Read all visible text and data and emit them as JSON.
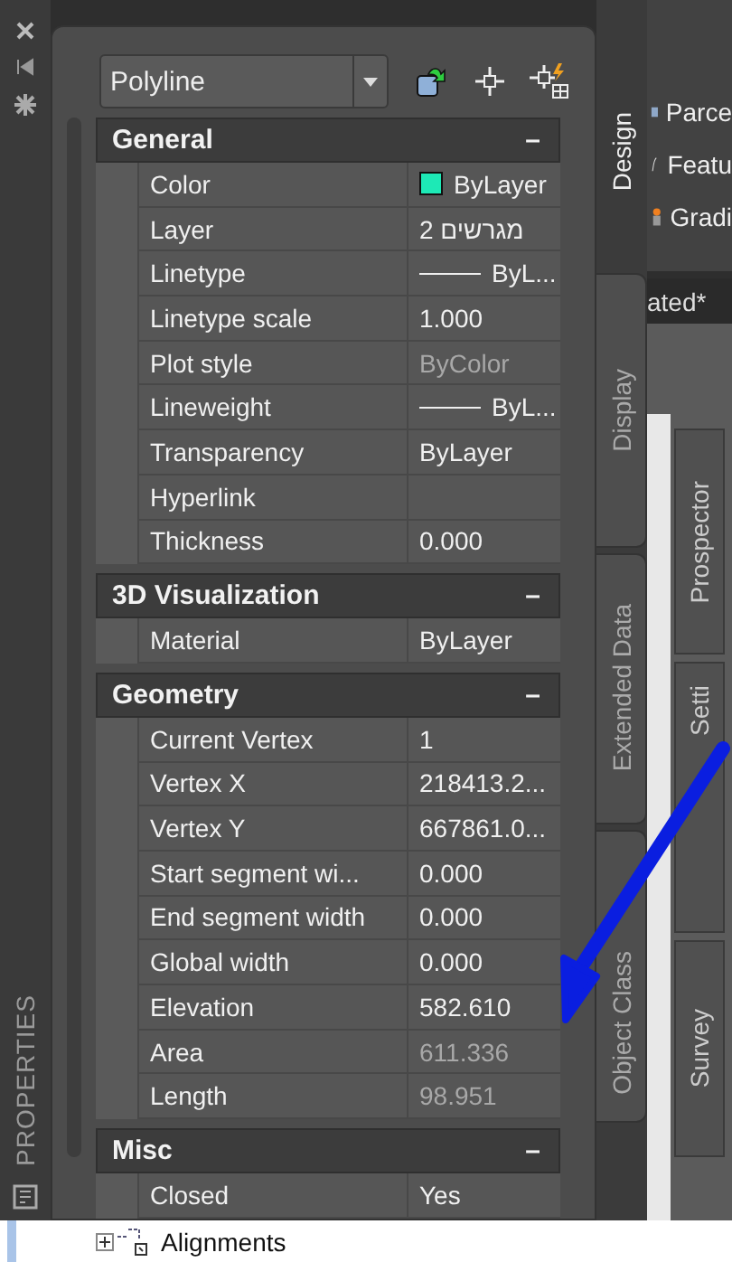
{
  "palette": {
    "title": "PROPERTIES",
    "object_type": "Polyline",
    "groups": [
      {
        "title": "General",
        "toggle": "–",
        "expanded": true,
        "rows": [
          {
            "label": "Color",
            "value": "ByLayer",
            "kind": "color",
            "color": "#1de9b6",
            "disabled": false
          },
          {
            "label": "Layer",
            "value": "מגרשים 2",
            "kind": "text",
            "disabled": false
          },
          {
            "label": "Linetype",
            "value": "ByL...",
            "kind": "line",
            "disabled": false
          },
          {
            "label": "Linetype scale",
            "value": "1.000",
            "kind": "text",
            "disabled": false
          },
          {
            "label": "Plot style",
            "value": "ByColor",
            "kind": "text",
            "disabled": true
          },
          {
            "label": "Lineweight",
            "value": "ByL...",
            "kind": "line",
            "disabled": false
          },
          {
            "label": "Transparency",
            "value": "ByLayer",
            "kind": "text",
            "disabled": false
          },
          {
            "label": "Hyperlink",
            "kind": "text",
            "disabled": false
          },
          {
            "label": "Thickness",
            "value": "0.000",
            "kind": "text",
            "disabled": false
          }
        ]
      },
      {
        "title": "3D Visualization",
        "toggle": "–",
        "expanded": true,
        "rows": [
          {
            "label": "Material",
            "value": "ByLayer",
            "kind": "text",
            "disabled": false
          }
        ]
      },
      {
        "title": "Geometry",
        "toggle": "–",
        "expanded": true,
        "rows": [
          {
            "label": "Current Vertex",
            "value": "1",
            "kind": "text",
            "disabled": false
          },
          {
            "label": "Vertex X",
            "value": "218413.2...",
            "kind": "text",
            "disabled": false
          },
          {
            "label": "Vertex Y",
            "value": "667861.0...",
            "kind": "text",
            "disabled": false
          },
          {
            "label": "Start segment wi...",
            "value": "0.000",
            "kind": "text",
            "disabled": false
          },
          {
            "label": "End segment width",
            "value": "0.000",
            "kind": "text",
            "disabled": false
          },
          {
            "label": "Global width",
            "value": "0.000",
            "kind": "text",
            "disabled": false
          },
          {
            "label": "Elevation",
            "value": "582.610",
            "kind": "text",
            "disabled": false
          },
          {
            "label": "Area",
            "value": "611.336",
            "kind": "text",
            "disabled": true
          },
          {
            "label": "Length",
            "value": "98.951",
            "kind": "text",
            "disabled": true
          }
        ]
      },
      {
        "title": "Misc",
        "toggle": "–",
        "expanded": true,
        "rows": [
          {
            "label": "Closed",
            "value": "Yes",
            "kind": "text",
            "disabled": false
          }
        ]
      }
    ],
    "side_tabs": [
      "Display",
      "Extended Data",
      "Object Class"
    ]
  },
  "ribbon": {
    "tab": "Design",
    "items": [
      "Parce",
      "Featu",
      "Gradi"
    ]
  },
  "document_tab": "ated*",
  "toolspace_tabs": [
    "Prospector",
    "Setti",
    "Survey"
  ],
  "tree": {
    "items": [
      {
        "label": "Alignments",
        "expanded": false
      }
    ]
  }
}
